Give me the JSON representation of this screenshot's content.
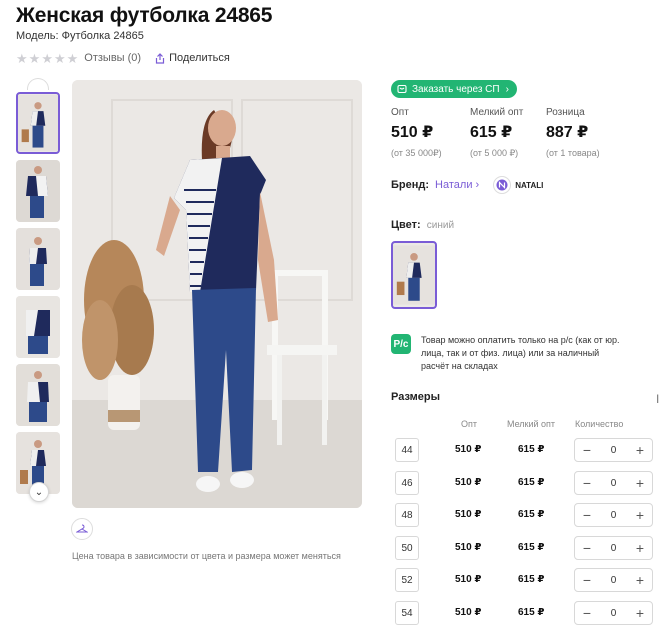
{
  "product": {
    "title": "Женская футболка 24865",
    "model": "Модель: Футболка 24865",
    "reviews": "Отзывы (0)",
    "share": "Поделиться",
    "rating_stars": 0
  },
  "order_button": "Заказать через СП",
  "prices": [
    {
      "label": "Опт",
      "value": "510 ₽",
      "sub": "(от 35 000₽)"
    },
    {
      "label": "Мелкий опт",
      "value": "615 ₽",
      "sub": "(от 5 000 ₽)"
    },
    {
      "label": "Розница",
      "value": "887 ₽",
      "sub": "(от 1 товара)"
    }
  ],
  "brand": {
    "label": "Бренд:",
    "link": "Натали",
    "logo_text": "NATALI"
  },
  "color": {
    "label": "Цвет:",
    "value": "синий"
  },
  "payment_note": "Товар можно оплатить только на р/с (как от юр. лица, так и от физ. лица) или за наличный расчёт на складах",
  "payment_icon_text": "Р/с",
  "sizes": {
    "title": "Размеры",
    "headers": {
      "opt": "Опт",
      "small_opt": "Мелкий опт",
      "qty": "Количество"
    },
    "rows": [
      {
        "size": "44",
        "opt": "510 ₽",
        "small_opt": "615 ₽",
        "qty": "0"
      },
      {
        "size": "46",
        "opt": "510 ₽",
        "small_opt": "615 ₽",
        "qty": "0"
      },
      {
        "size": "48",
        "opt": "510 ₽",
        "small_opt": "615 ₽",
        "qty": "0"
      },
      {
        "size": "50",
        "opt": "510 ₽",
        "small_opt": "615 ₽",
        "qty": "0"
      },
      {
        "size": "52",
        "opt": "510 ₽",
        "small_opt": "615 ₽",
        "qty": "0"
      },
      {
        "size": "54",
        "opt": "510 ₽",
        "small_opt": "615 ₽",
        "qty": "0"
      }
    ]
  },
  "price_note": "Цена товара в зависимости от цвета и размера может меняться",
  "colors": {
    "accent": "#7a5cd6",
    "green": "#22b573",
    "navy": "#1f2a5c"
  }
}
